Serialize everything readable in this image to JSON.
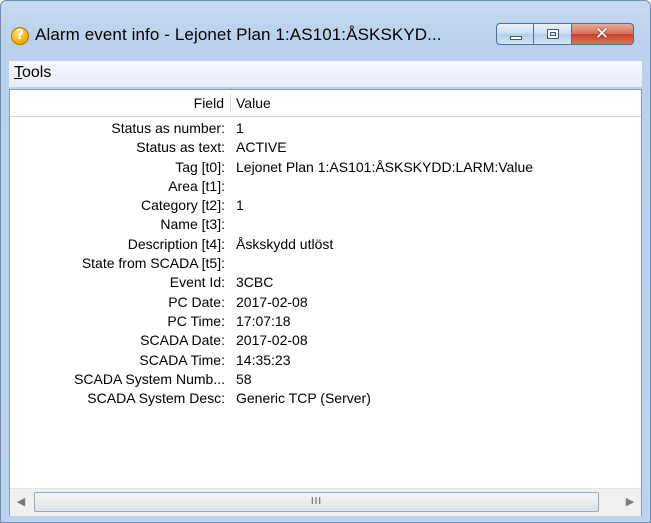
{
  "window": {
    "title": "Alarm event info - Lejonet Plan 1:AS101:ÅSKSKYD...",
    "title_icon": "help-question-icon",
    "close_glyph": "✕"
  },
  "menu": {
    "tools_underlined": "T",
    "tools_rest": "ools"
  },
  "table": {
    "header_field": "Field",
    "header_value": "Value",
    "rows": [
      {
        "field": "Status as number:",
        "value": "1"
      },
      {
        "field": "Status as text:",
        "value": "ACTIVE"
      },
      {
        "field": "Tag [t0]:",
        "value": "Lejonet Plan 1:AS101:ÅSKSKYDD:LARM:Value"
      },
      {
        "field": "Area [t1]:",
        "value": ""
      },
      {
        "field": "Category [t2]:",
        "value": "1"
      },
      {
        "field": "Name [t3]:",
        "value": ""
      },
      {
        "field": "Description [t4]:",
        "value": "Åskskydd utlöst"
      },
      {
        "field": "State from SCADA [t5]:",
        "value": ""
      },
      {
        "field": "Event Id:",
        "value": "3CBC"
      },
      {
        "field": "PC Date:",
        "value": "2017-02-08"
      },
      {
        "field": "PC Time:",
        "value": "17:07:18"
      },
      {
        "field": "SCADA Date:",
        "value": "2017-02-08"
      },
      {
        "field": "SCADA Time:",
        "value": "14:35:23"
      },
      {
        "field": "SCADA System Numb...",
        "value": "58"
      },
      {
        "field": "SCADA System Desc:",
        "value": "Generic TCP (Server)"
      }
    ]
  },
  "scrollbar": {
    "left_arrow": "◀",
    "right_arrow": "▶",
    "grip": "III"
  },
  "colors": {
    "title_bar": "#bcd3ee",
    "close_button": "#c64327"
  }
}
